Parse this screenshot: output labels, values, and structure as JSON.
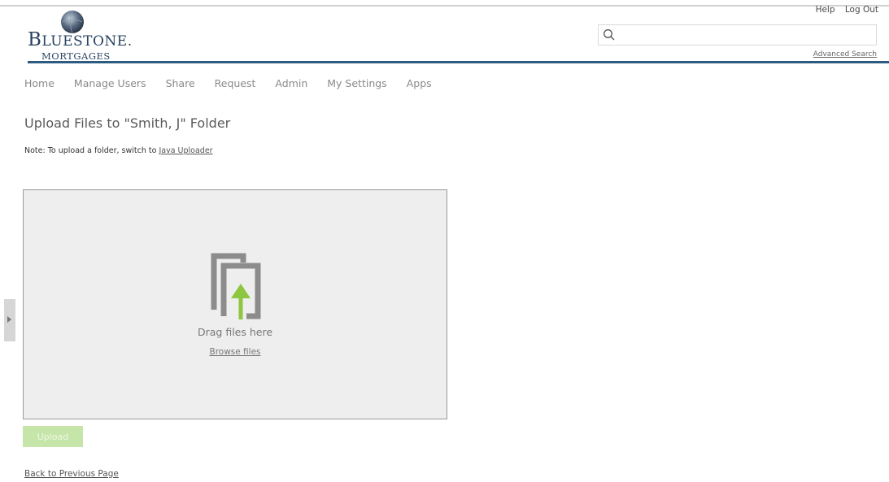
{
  "header": {
    "logo": {
      "name_large_b": "B",
      "name_small": "LUESTONE",
      "name_dot": ".",
      "sub": "MORTGAGES"
    },
    "links": {
      "help": "Help",
      "logout": "Log Out"
    },
    "search": {
      "value": "",
      "placeholder": "",
      "icon": "search-icon"
    },
    "advanced_search": "Advanced Search"
  },
  "nav": {
    "items": [
      "Home",
      "Manage Users",
      "Share",
      "Request",
      "Admin",
      "My Settings",
      "Apps"
    ]
  },
  "main": {
    "title": "Upload Files to \"Smith, J\" Folder",
    "note_prefix": "Note: To upload a folder, switch to ",
    "note_link": "Java Uploader",
    "drop_zone": {
      "icon": "upload-files-icon",
      "drag_text": "Drag files here",
      "browse_label": "Browse files"
    },
    "upload_button": "Upload",
    "back_link": "Back to Previous Page"
  },
  "colors": {
    "brand_navy": "#27415f",
    "header_rule": "#2d5a80",
    "upload_accent": "#8dc63f",
    "upload_button_disabled": "#c6e5a9"
  }
}
